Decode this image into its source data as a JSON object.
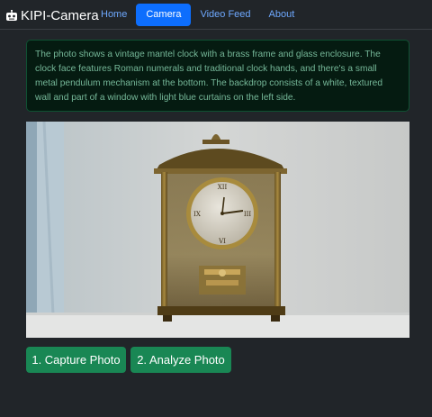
{
  "navbar": {
    "brand": "KIPI-Camera",
    "brand_icon": "robot-icon",
    "links": [
      {
        "label": "Home",
        "active": false
      },
      {
        "label": "Camera",
        "active": true
      },
      {
        "label": "Video Feed",
        "active": false
      },
      {
        "label": "About",
        "active": false
      }
    ]
  },
  "analysis": {
    "text": "The photo shows a vintage mantel clock with a brass frame and glass enclosure. The clock face features Roman numerals and traditional clock hands, and there's a small metal pendulum mechanism at the bottom. The backdrop consists of a white, textured wall and part of a window with light blue curtains on the left side."
  },
  "buttons": {
    "capture_label": "1. Capture Photo",
    "analyze_label": "2. Analyze Photo"
  },
  "colors": {
    "navbar_bg": "#212529",
    "active_nav": "#0d6efd",
    "link": "#6ea8fe",
    "alert_bg": "#051b11",
    "alert_text": "#75b798",
    "button_green": "#198754"
  }
}
